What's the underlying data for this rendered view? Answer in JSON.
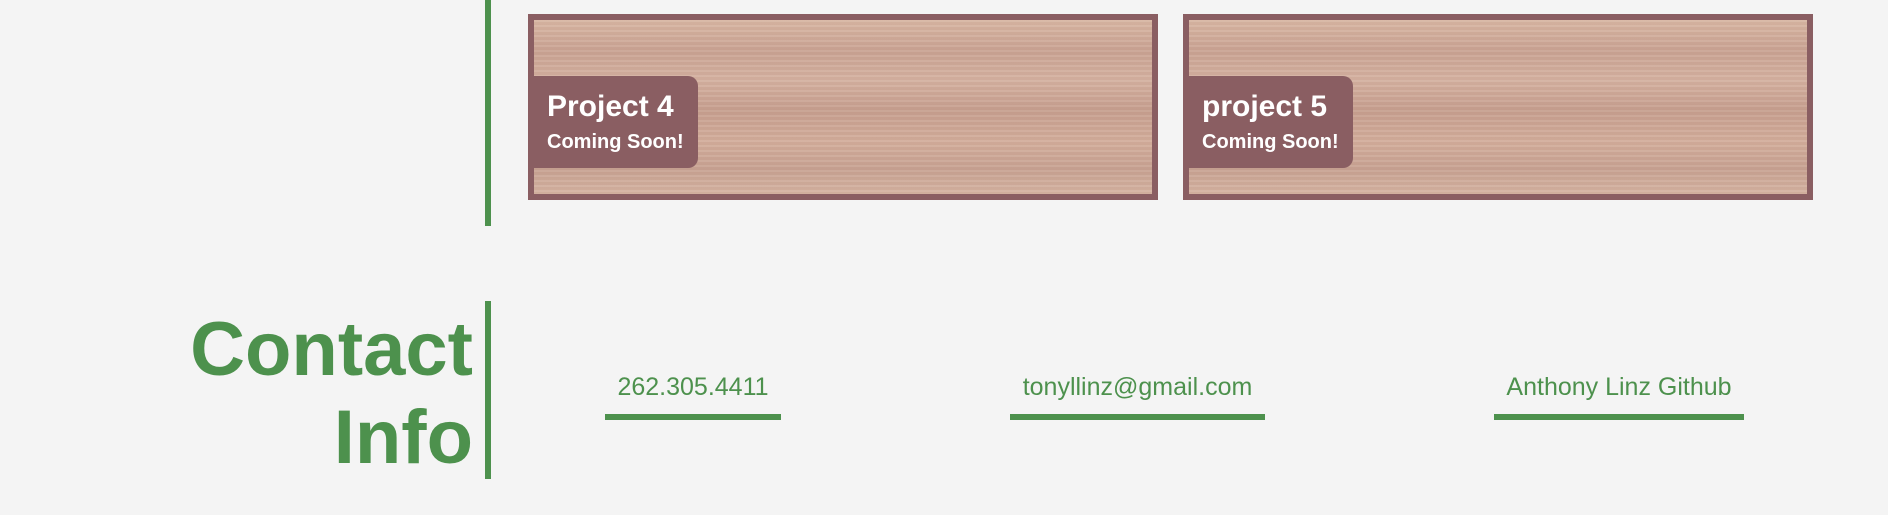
{
  "projects": [
    {
      "title": "Project 4",
      "subtitle": "Coming Soon!"
    },
    {
      "title": "project 5",
      "subtitle": "Coming Soon!"
    }
  ],
  "contact": {
    "heading_line1": "Contact",
    "heading_line2": "Info",
    "phone": "262.305.4411",
    "email": "tonyllinz@gmail.com",
    "github": "Anthony Linz Github"
  },
  "colors": {
    "accent_green": "#4d914d",
    "card_mauve": "#8a5e62",
    "background": "#f4f4f4"
  }
}
